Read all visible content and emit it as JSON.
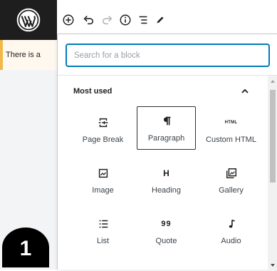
{
  "toolbar": {
    "tools": [
      "add-block",
      "undo",
      "redo",
      "info",
      "outline",
      "edit"
    ]
  },
  "notice": {
    "text": "There is a"
  },
  "inserter": {
    "search_placeholder": "Search for a block",
    "section_title": "Most used",
    "blocks": [
      {
        "label": "Page Break",
        "icon": "page-break-icon"
      },
      {
        "label": "Paragraph",
        "icon": "paragraph-icon",
        "selected": true
      },
      {
        "label": "Custom HTML",
        "icon": "html-icon",
        "icon_text": "HTML"
      },
      {
        "label": "Image",
        "icon": "image-icon"
      },
      {
        "label": "Heading",
        "icon": "heading-icon",
        "icon_text": "H"
      },
      {
        "label": "Gallery",
        "icon": "gallery-icon"
      },
      {
        "label": "List",
        "icon": "list-icon"
      },
      {
        "label": "Quote",
        "icon": "quote-icon",
        "icon_text": "99"
      },
      {
        "label": "Audio",
        "icon": "audio-icon"
      }
    ]
  },
  "badge": {
    "number": "1"
  },
  "colors": {
    "accent": "#007cba",
    "dark": "#1e1e1e",
    "notice_border": "#f0b849"
  }
}
